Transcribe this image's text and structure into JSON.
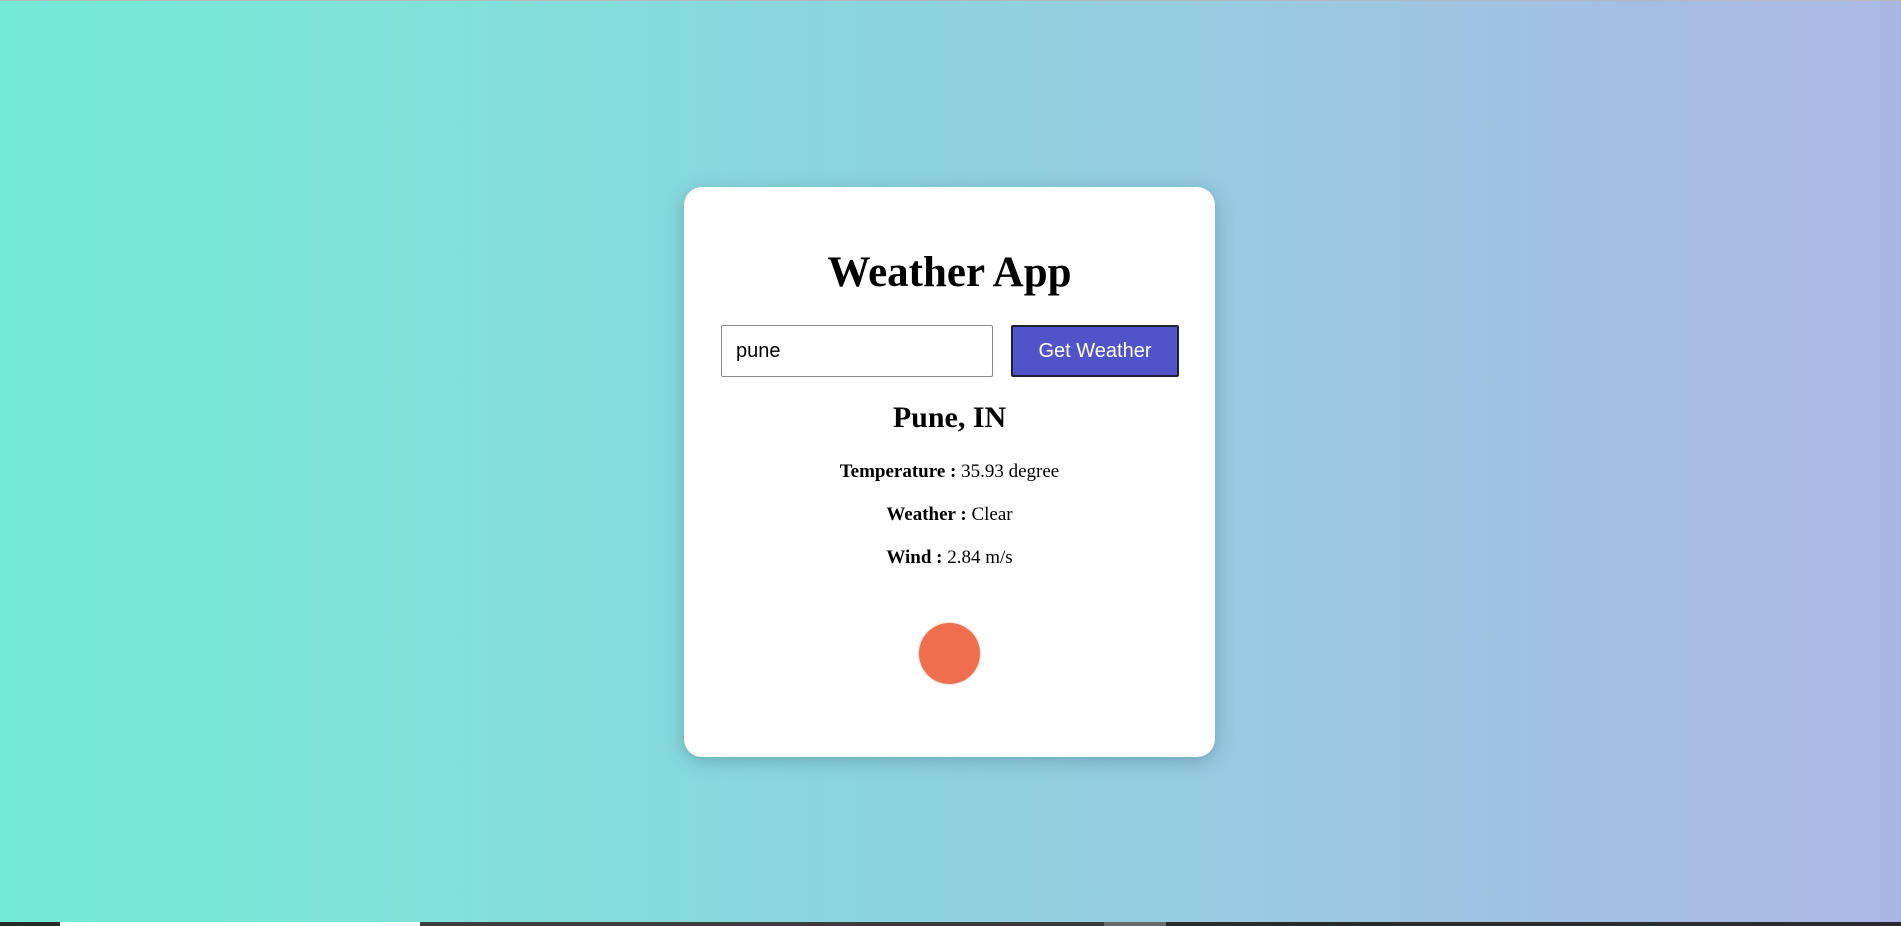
{
  "app": {
    "title": "Weather App"
  },
  "search": {
    "value": "pune",
    "placeholder": "",
    "button_label": "Get Weather"
  },
  "result": {
    "city": "Pune, IN",
    "temperature_label": "Temperature :",
    "temperature_value": "35.93 degree",
    "weather_label": "Weather :",
    "weather_value": "Clear",
    "wind_label": "Wind :",
    "wind_value": "2.84 m/s",
    "icon": "sun-icon"
  },
  "colors": {
    "background_gradient": [
      "#74ebd5",
      "#acb6e5"
    ],
    "button": "#5154c9",
    "sun": "#ef6e4d",
    "card": "#ffffff"
  }
}
